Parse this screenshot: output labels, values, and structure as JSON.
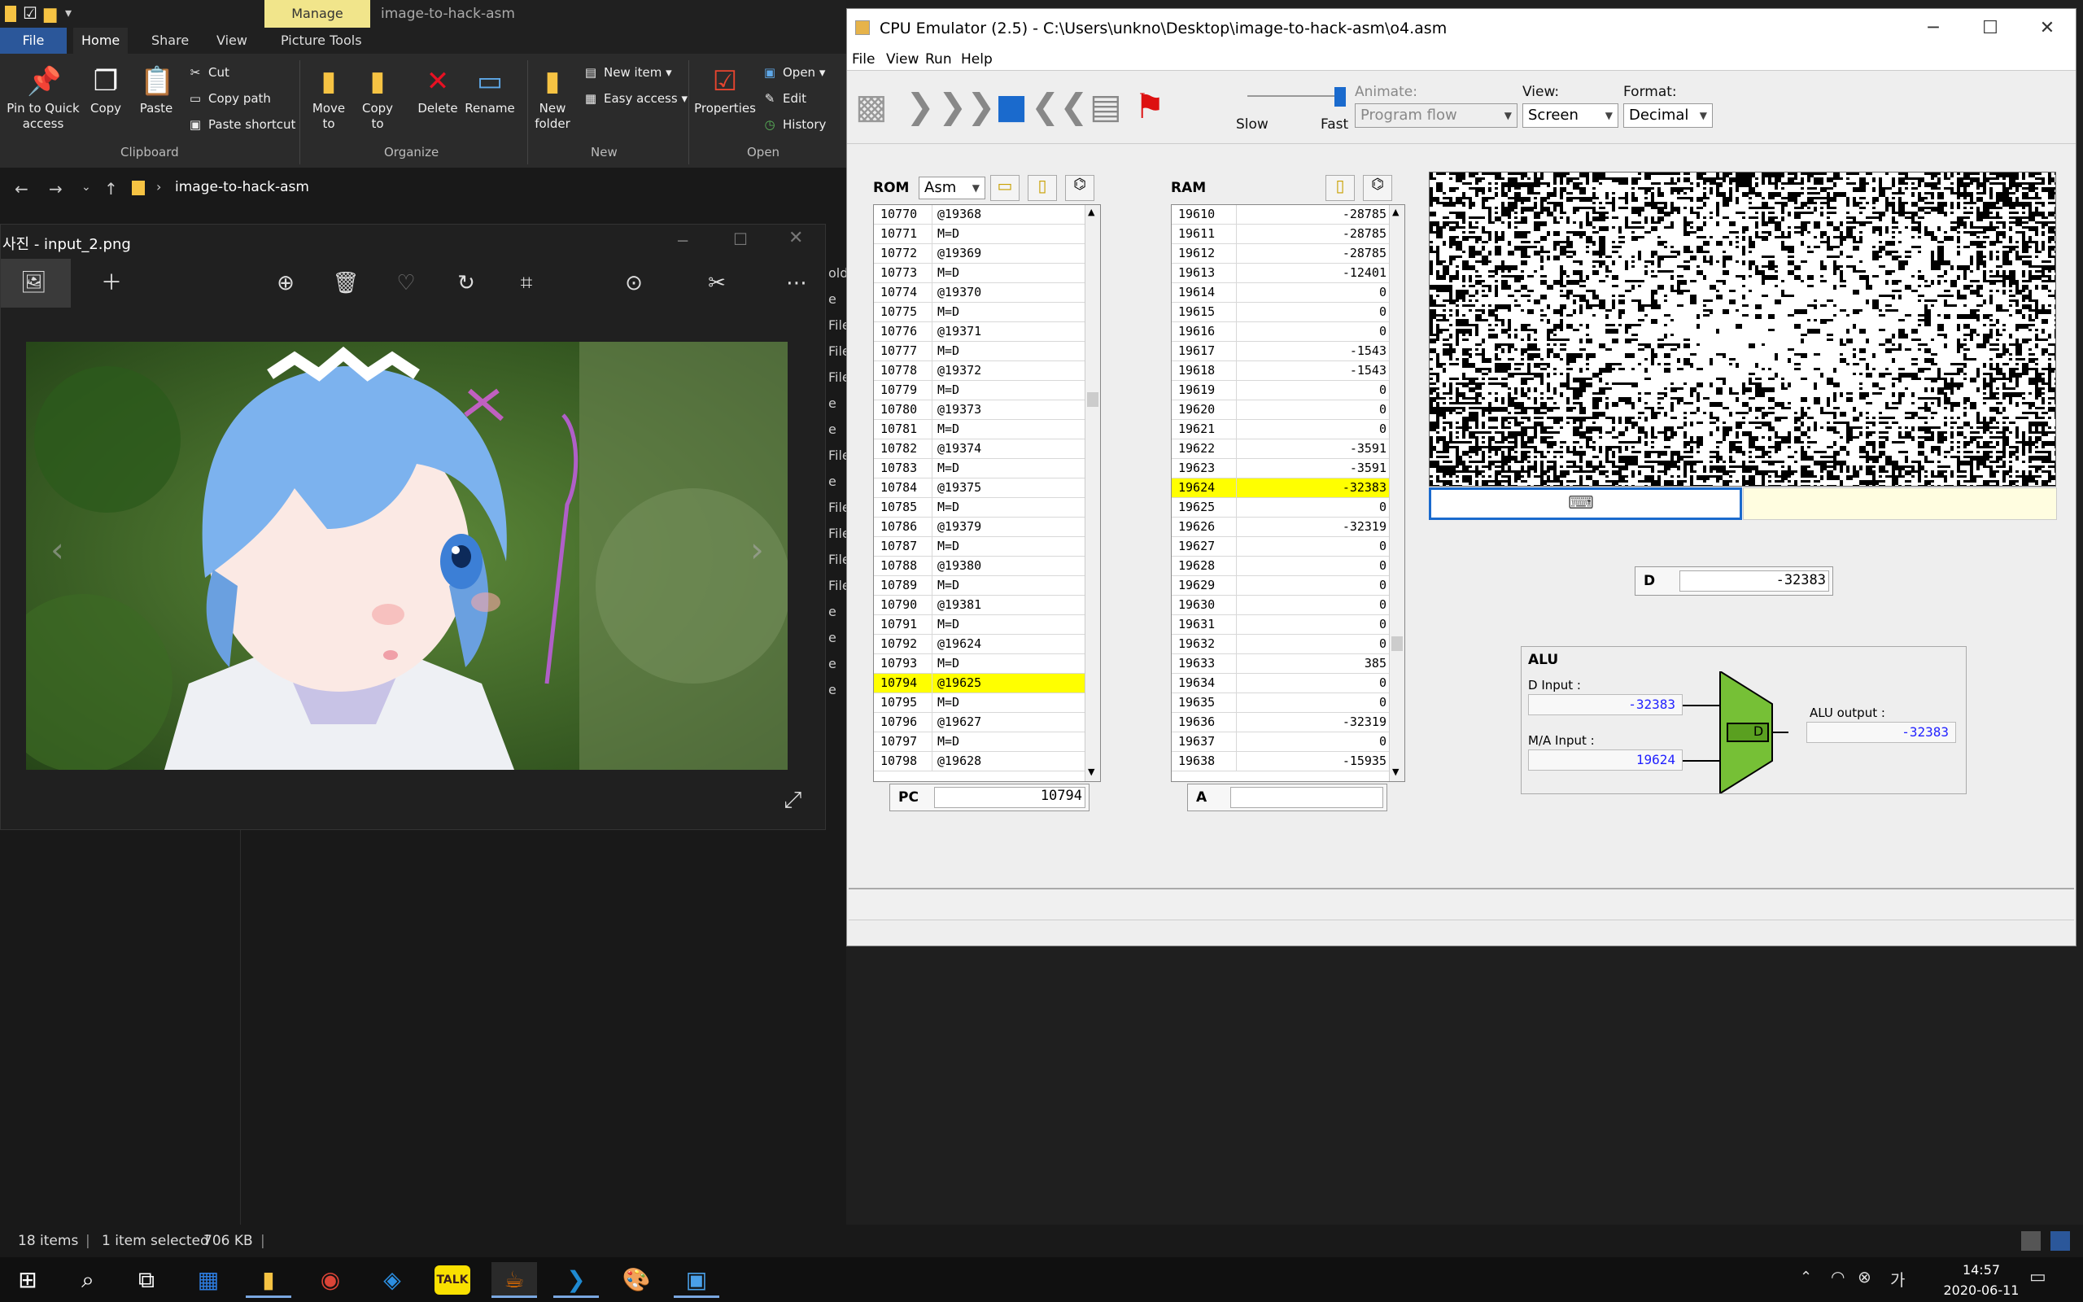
{
  "explorer": {
    "manage_tab": "Manage",
    "title": "image-to-hack-asm",
    "tabs": [
      "File",
      "Home",
      "Share",
      "View",
      "Picture Tools"
    ],
    "ribbon": {
      "pin": "Pin to Quick access",
      "copy": "Copy",
      "paste": "Paste",
      "cut": "Cut",
      "copy_path": "Copy path",
      "paste_shortcut": "Paste shortcut",
      "clipboard": "Clipboard",
      "move_to": "Move to",
      "copy_to": "Copy to",
      "delete": "Delete",
      "rename": "Rename",
      "organize": "Organize",
      "new_folder": "New folder",
      "new_item": "New item",
      "easy_access": "Easy access",
      "new_group": "New",
      "properties": "Properties",
      "open": "Open",
      "edit": "Edit",
      "history": "History",
      "open_group": "Open"
    },
    "address": "image-to-hack-asm",
    "status": {
      "items": "18 items",
      "selected": "1 item selected",
      "size": "706 KB"
    },
    "list_fragment": [
      "olde",
      "e",
      "File",
      "File",
      "File",
      "e",
      "e",
      "File",
      "e",
      "File",
      "File",
      "File",
      "File",
      "e",
      "e",
      "e",
      "e"
    ]
  },
  "photos": {
    "title": "사진 - input_2.png"
  },
  "cpu": {
    "title": "CPU Emulator (2.5) - C:\\Users\\unkno\\Desktop\\image-to-hack-asm\\o4.asm",
    "menu": [
      "File",
      "View",
      "Run",
      "Help"
    ],
    "speed_slow": "Slow",
    "speed_fast": "Fast",
    "speed_level": 0.95,
    "animate_label": "Animate:",
    "animate_value": "Program flow",
    "view_label": "View:",
    "view_value": "Screen",
    "format_label": "Format:",
    "format_value": "Decimal",
    "rom_label": "ROM",
    "rom_format": "Asm",
    "ram_label": "RAM",
    "rom": [
      [
        "10770",
        "@19368"
      ],
      [
        "10771",
        "M=D"
      ],
      [
        "10772",
        "@19369"
      ],
      [
        "10773",
        "M=D"
      ],
      [
        "10774",
        "@19370"
      ],
      [
        "10775",
        "M=D"
      ],
      [
        "10776",
        "@19371"
      ],
      [
        "10777",
        "M=D"
      ],
      [
        "10778",
        "@19372"
      ],
      [
        "10779",
        "M=D"
      ],
      [
        "10780",
        "@19373"
      ],
      [
        "10781",
        "M=D"
      ],
      [
        "10782",
        "@19374"
      ],
      [
        "10783",
        "M=D"
      ],
      [
        "10784",
        "@19375"
      ],
      [
        "10785",
        "M=D"
      ],
      [
        "10786",
        "@19379"
      ],
      [
        "10787",
        "M=D"
      ],
      [
        "10788",
        "@19380"
      ],
      [
        "10789",
        "M=D"
      ],
      [
        "10790",
        "@19381"
      ],
      [
        "10791",
        "M=D"
      ],
      [
        "10792",
        "@19624"
      ],
      [
        "10793",
        "M=D"
      ],
      [
        "10794",
        "@19625"
      ],
      [
        "10795",
        "M=D"
      ],
      [
        "10796",
        "@19627"
      ],
      [
        "10797",
        "M=D"
      ],
      [
        "10798",
        "@19628"
      ]
    ],
    "rom_highlight": "10794",
    "ram": [
      [
        "19610",
        "-28785"
      ],
      [
        "19611",
        "-28785"
      ],
      [
        "19612",
        "-28785"
      ],
      [
        "19613",
        "-12401"
      ],
      [
        "19614",
        "0"
      ],
      [
        "19615",
        "0"
      ],
      [
        "19616",
        "0"
      ],
      [
        "19617",
        "-1543"
      ],
      [
        "19618",
        "-1543"
      ],
      [
        "19619",
        "0"
      ],
      [
        "19620",
        "0"
      ],
      [
        "19621",
        "0"
      ],
      [
        "19622",
        "-3591"
      ],
      [
        "19623",
        "-3591"
      ],
      [
        "19624",
        "-32383"
      ],
      [
        "19625",
        "0"
      ],
      [
        "19626",
        "-32319"
      ],
      [
        "19627",
        "0"
      ],
      [
        "19628",
        "0"
      ],
      [
        "19629",
        "0"
      ],
      [
        "19630",
        "0"
      ],
      [
        "19631",
        "0"
      ],
      [
        "19632",
        "0"
      ],
      [
        "19633",
        "385"
      ],
      [
        "19634",
        "0"
      ],
      [
        "19635",
        "0"
      ],
      [
        "19636",
        "-32319"
      ],
      [
        "19637",
        "0"
      ],
      [
        "19638",
        "-15935"
      ]
    ],
    "ram_highlight": "19624",
    "pc_label": "PC",
    "pc_value": "10794",
    "a_label": "A",
    "a_value": "",
    "d_label": "D",
    "d_value": "-32383",
    "alu": {
      "title": "ALU",
      "d_input_label": "D Input :",
      "d_input": "-32383",
      "ma_input_label": "M/A Input :",
      "ma_input": "19624",
      "output_label": "ALU output :",
      "output": "-32383",
      "op": "D"
    }
  },
  "taskbar": {
    "time": "14:57",
    "date": "2020-06-11",
    "kakao": "TALK"
  }
}
